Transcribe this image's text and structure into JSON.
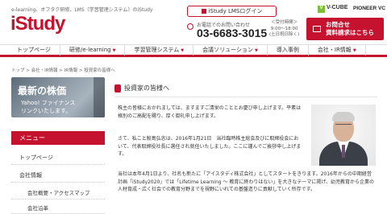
{
  "header": {
    "tagline": "e-learning、オフタク研修、LMS（学習管理システム）のiStudy",
    "logo": "iStudy",
    "login_label": "iStudy LMSログイン",
    "phone_label": "お電話でのお問い合わせ",
    "phone_number": "03-6683-3015",
    "hours_line1": "＜受付時間＞",
    "hours_line2": "9:00〜18:00",
    "hours_line3": "(土日祝日除く)",
    "contact_line1": "お問合せ",
    "contact_line2": "資料請求はこちら",
    "partner_1": "V-CUBE",
    "partner_1_mark": "V",
    "partner_2": "PIONEER VC"
  },
  "nav": {
    "items": [
      {
        "label": "トップページ"
      },
      {
        "label": "研修/e-learning"
      },
      {
        "label": "学習管理システム"
      },
      {
        "label": "会議ソリューション"
      },
      {
        "label": "導入事例"
      },
      {
        "label": "会社・IR情報"
      }
    ]
  },
  "breadcrumb": "トップ > 会社・IR情報 > IR情報 > 投資家の皆様へ",
  "banner": {
    "title": "最新の株価",
    "line1": "Yahoo! ファイナンス",
    "line2": "リンクいたします。"
  },
  "sidebar": {
    "heading": "メニュー",
    "items": [
      {
        "label": "トップページ"
      },
      {
        "label": "会社情報"
      },
      {
        "label": "会社概要・アクセスマップ"
      },
      {
        "label": "会社沿革"
      }
    ]
  },
  "main": {
    "heading": "投資家の皆様へ",
    "para1": "株主の皆様におかれましては、ますますご清栄のこととお慶び申し上げます。平素は格別のご高配を賜り、厚く御礼申し上げます。",
    "para2": "さて、私こと鮫島弘忠は、2016年1月21日　当社臨時株主総会及びに取締役会において、代表取締役社長に選任され就任いたしました。ここに謹んでご挨拶申し上げます。",
    "para3": "当社は本年4月1日より、社名も新たに「アイスタディ株式会社」としてスタートをきります。2016年からの中期経営計画「iStudy2020」では「Lifetime Learning 〜 教育に終わりはない」を大きなテーマに掲げ、幼児教育から企業の人材育成・広く社会での教育分野までを視野にいれての基盤造りに貢献していく所存です。"
  },
  "colors": {
    "brand": "#c4122f"
  }
}
